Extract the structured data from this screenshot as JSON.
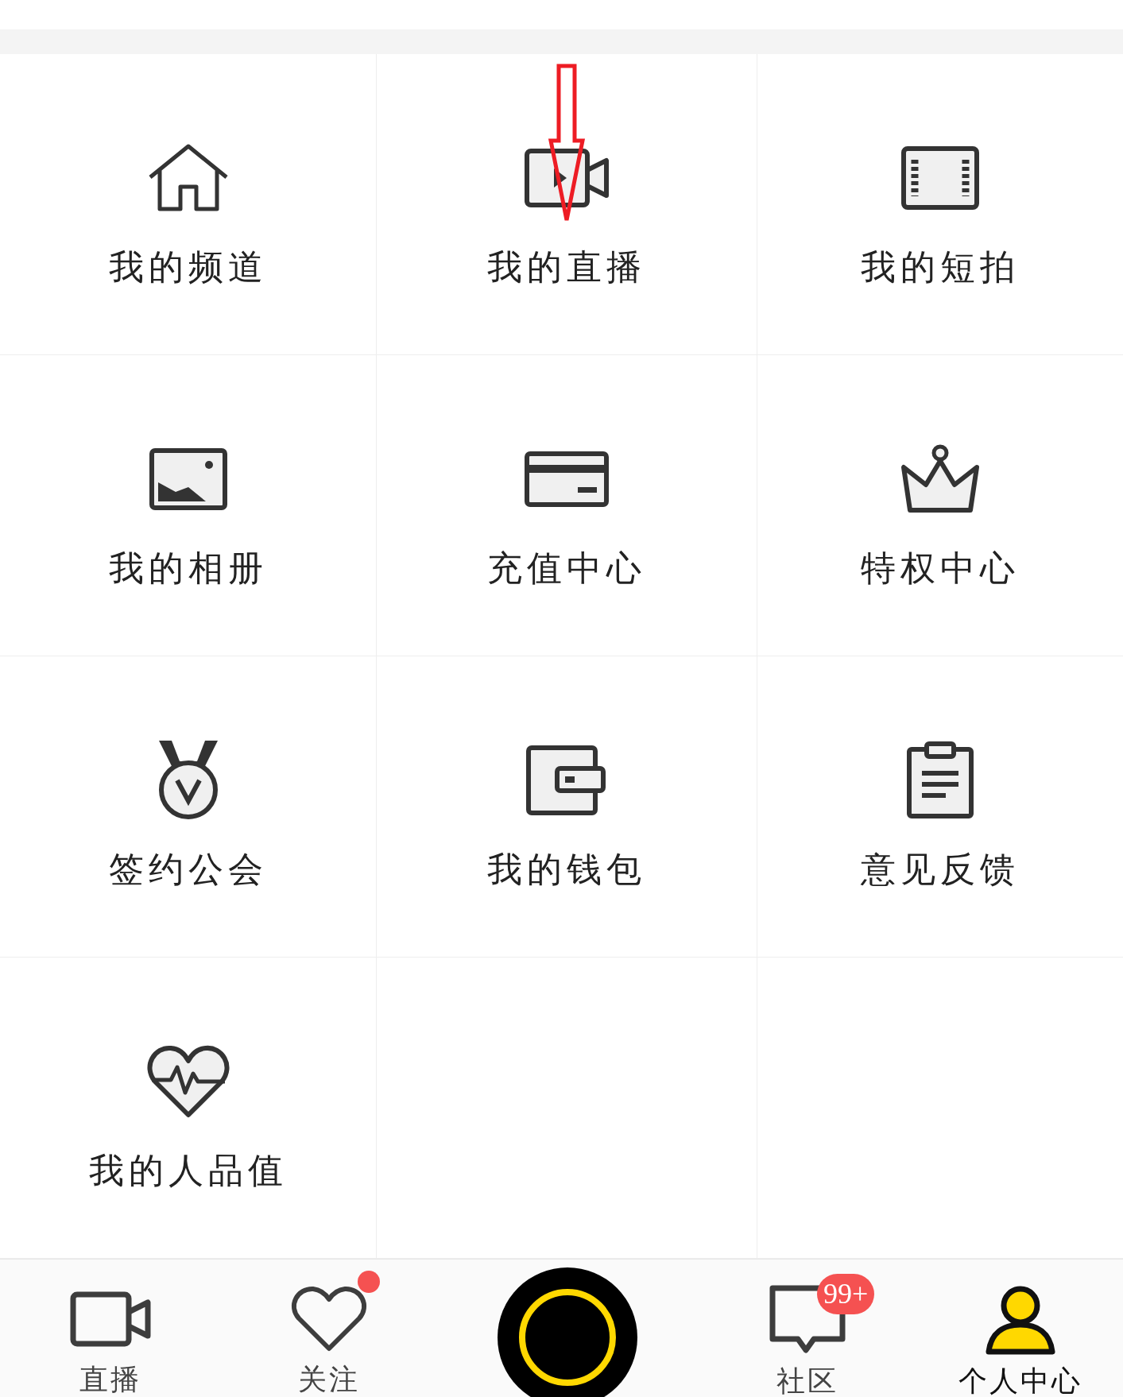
{
  "menu": [
    {
      "label": "我的频道",
      "marked": false
    },
    {
      "label": "我的直播",
      "marked": true
    },
    {
      "label": "我的短拍",
      "marked": false
    },
    {
      "label": "我的相册",
      "marked": false
    },
    {
      "label": "充值中心",
      "marked": false
    },
    {
      "label": "特权中心",
      "marked": false
    },
    {
      "label": "签约公会",
      "marked": false
    },
    {
      "label": "我的钱包",
      "marked": false
    },
    {
      "label": "意见反馈",
      "marked": false
    },
    {
      "label": "我的人品值",
      "marked": false
    }
  ],
  "tab_bar": [
    {
      "kind": "tab",
      "label": "直播",
      "selected": false
    },
    {
      "kind": "tab",
      "label": "关注",
      "selected": false,
      "dot": true
    },
    {
      "kind": "record"
    },
    {
      "kind": "tab",
      "label": "社区",
      "selected": false,
      "badge": "99+"
    },
    {
      "kind": "tab",
      "label": "个人中心",
      "selected": true
    }
  ]
}
